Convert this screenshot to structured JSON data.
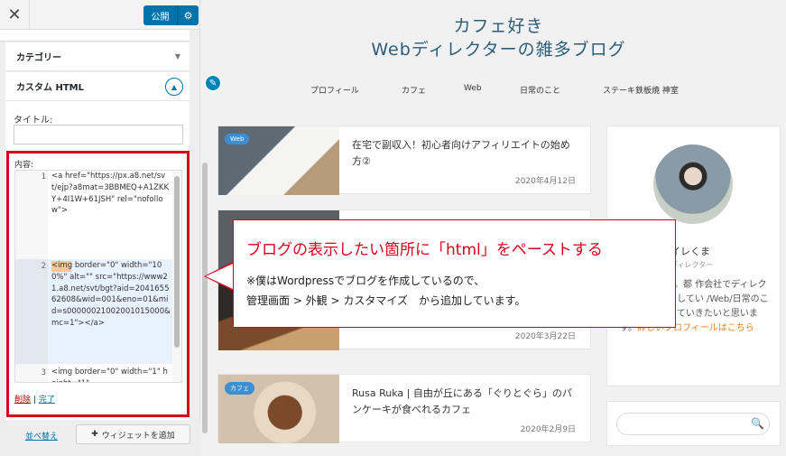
{
  "panel": {
    "close_label": "✕",
    "publish_label": "公開",
    "gear_label": "⚙",
    "widgets": {
      "category_title": "カテゴリー",
      "custom_html_title": "カスタム HTML",
      "collapse_glyph": "▲",
      "expand_glyph": "▼"
    },
    "title_label": "タイトル:",
    "content_label": "内容:",
    "code_lines": [
      {
        "num": "1",
        "text": "<a href=\"https://px.a8.net/svt/ejp?a8mat=3BBMEQ+A1ZKKY+4I1W+61JSH\" rel=\"nofollow\">"
      },
      {
        "num": "2",
        "text": "<img border=\"0\" width=\"100%\"  alt=\"\" src=\"https://www21.a8.net/svt/bgt?aid=204165562608&wid=001&eno=01&mid=s00000021002001015000&mc=1\"></a>"
      },
      {
        "num": "3",
        "text": "<img border=\"0\" width=\"1\" height=\"1\""
      }
    ],
    "delete_label": "削除",
    "separator": "|",
    "done_label": "完了",
    "reorder_label": "並べ替え",
    "add_widget_label": "ウィジェットを追加"
  },
  "preview": {
    "site_title_line1": "カフェ好き",
    "site_title_line2": "Webディレクターの雑多ブログ",
    "nav": [
      "プロフィール",
      "カフェ",
      "Web",
      "日常のこと",
      "ステーキ鉄板焼 神室"
    ],
    "posts": [
      {
        "badge": "Web",
        "title": "在宅で副収入！初心者向けアフィリエイトの始め方②",
        "date": "2020年4月12日"
      },
      {
        "badge": "",
        "title": "",
        "date": "2020年3月22日"
      },
      {
        "badge": "カフェ",
        "title": "Rusa Ruka | 自由が丘にある「ぐりとぐら」のパンケーキが食べれるカフェ",
        "date": "2020年2月9日"
      }
    ],
    "profile": {
      "name": "イレくま",
      "role": "ディレクター",
      "bio": "れ山形県出身。都 作会社でディレクタ カフェ巡りしてい /Web/日常のこと 等を発信していきたいと思います。",
      "link": "詳しいプロフィールはこちら"
    },
    "search_icon": "🔍"
  },
  "callout": {
    "main": "ブログの表示したい箇所に「html」をペーストする",
    "sub1": "※僕はWordpressでブログを作成しているので、",
    "sub2": "管理画面 > 外観 > カスタマイズ　から追加しています。"
  }
}
